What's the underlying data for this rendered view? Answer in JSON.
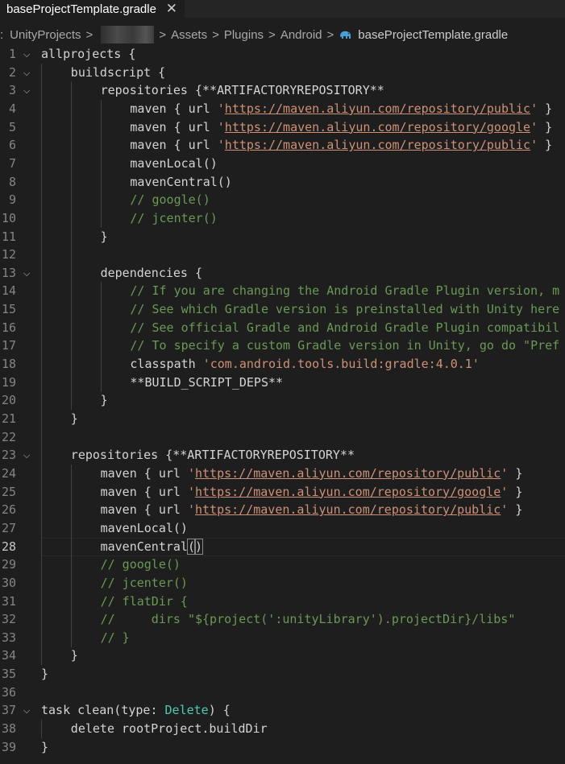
{
  "tab": {
    "title": "baseProjectTemplate.gradle",
    "close_glyph": "✕"
  },
  "breadcrumb": {
    "lead": ":",
    "items": [
      "UnityProjects",
      "Assets",
      "Plugins",
      "Android"
    ],
    "file": "baseProjectTemplate.gradle",
    "separator": ">"
  },
  "editor": {
    "active_line": 28,
    "lines": [
      {
        "n": "1",
        "fold": true,
        "indent": 0,
        "tokens": [
          {
            "t": "allprojects {",
            "c": "kw"
          }
        ]
      },
      {
        "n": "2",
        "fold": true,
        "indent": 1,
        "tokens": [
          {
            "t": "buildscript {",
            "c": "kw"
          }
        ]
      },
      {
        "n": "3",
        "fold": true,
        "indent": 2,
        "tokens": [
          {
            "t": "repositories {**ARTIFACTORYREPOSITORY**",
            "c": "kw"
          }
        ]
      },
      {
        "n": "4",
        "fold": false,
        "indent": 3,
        "tokens": [
          {
            "t": "maven { url ",
            "c": "kw"
          },
          {
            "t": "'",
            "c": "str"
          },
          {
            "t": "https://maven.aliyun.com/repository/public",
            "c": "url"
          },
          {
            "t": "'",
            "c": "str"
          },
          {
            "t": " }",
            "c": "kw"
          }
        ]
      },
      {
        "n": "5",
        "fold": false,
        "indent": 3,
        "tokens": [
          {
            "t": "maven { url ",
            "c": "kw"
          },
          {
            "t": "'",
            "c": "str"
          },
          {
            "t": "https://maven.aliyun.com/repository/google",
            "c": "url"
          },
          {
            "t": "'",
            "c": "str"
          },
          {
            "t": " }",
            "c": "kw"
          }
        ]
      },
      {
        "n": "6",
        "fold": false,
        "indent": 3,
        "tokens": [
          {
            "t": "maven { url ",
            "c": "kw"
          },
          {
            "t": "'",
            "c": "str"
          },
          {
            "t": "https://maven.aliyun.com/repository/public",
            "c": "url"
          },
          {
            "t": "'",
            "c": "str"
          },
          {
            "t": " }",
            "c": "kw"
          }
        ]
      },
      {
        "n": "7",
        "fold": false,
        "indent": 3,
        "tokens": [
          {
            "t": "mavenLocal()",
            "c": "kw"
          }
        ]
      },
      {
        "n": "8",
        "fold": false,
        "indent": 3,
        "tokens": [
          {
            "t": "mavenCentral()",
            "c": "kw"
          }
        ]
      },
      {
        "n": "9",
        "fold": false,
        "indent": 3,
        "tokens": [
          {
            "t": "// google()",
            "c": "cmt"
          }
        ]
      },
      {
        "n": "10",
        "fold": false,
        "indent": 3,
        "tokens": [
          {
            "t": "// jcenter()",
            "c": "cmt"
          }
        ]
      },
      {
        "n": "11",
        "fold": false,
        "indent": 2,
        "tokens": [
          {
            "t": "}",
            "c": "kw"
          }
        ]
      },
      {
        "n": "12",
        "fold": false,
        "indent": 2,
        "tokens": []
      },
      {
        "n": "13",
        "fold": true,
        "indent": 2,
        "tokens": [
          {
            "t": "dependencies {",
            "c": "kw"
          }
        ]
      },
      {
        "n": "14",
        "fold": false,
        "indent": 3,
        "tokens": [
          {
            "t": "// If you are changing the Android Gradle Plugin version, m",
            "c": "cmt"
          }
        ]
      },
      {
        "n": "15",
        "fold": false,
        "indent": 3,
        "tokens": [
          {
            "t": "// See which Gradle version is preinstalled with Unity here",
            "c": "cmt"
          }
        ]
      },
      {
        "n": "16",
        "fold": false,
        "indent": 3,
        "tokens": [
          {
            "t": "// See official Gradle and Android Gradle Plugin compatibil",
            "c": "cmt"
          }
        ]
      },
      {
        "n": "17",
        "fold": false,
        "indent": 3,
        "tokens": [
          {
            "t": "// To specify a custom Gradle version in Unity, go do \"Pref",
            "c": "cmt"
          }
        ]
      },
      {
        "n": "18",
        "fold": false,
        "indent": 3,
        "tokens": [
          {
            "t": "classpath ",
            "c": "kw"
          },
          {
            "t": "'com.android.tools.build:gradle:4.0.1'",
            "c": "str"
          }
        ]
      },
      {
        "n": "19",
        "fold": false,
        "indent": 3,
        "tokens": [
          {
            "t": "**BUILD_SCRIPT_DEPS**",
            "c": "kw"
          }
        ]
      },
      {
        "n": "20",
        "fold": false,
        "indent": 2,
        "tokens": [
          {
            "t": "}",
            "c": "kw"
          }
        ]
      },
      {
        "n": "21",
        "fold": false,
        "indent": 1,
        "tokens": [
          {
            "t": "}",
            "c": "kw"
          }
        ]
      },
      {
        "n": "22",
        "fold": false,
        "indent": 1,
        "tokens": []
      },
      {
        "n": "23",
        "fold": true,
        "indent": 1,
        "tokens": [
          {
            "t": "repositories {**ARTIFACTORYREPOSITORY**",
            "c": "kw"
          }
        ]
      },
      {
        "n": "24",
        "fold": false,
        "indent": 2,
        "tokens": [
          {
            "t": "maven { url ",
            "c": "kw"
          },
          {
            "t": "'",
            "c": "str"
          },
          {
            "t": "https://maven.aliyun.com/repository/public",
            "c": "url"
          },
          {
            "t": "'",
            "c": "str"
          },
          {
            "t": " }",
            "c": "kw"
          }
        ]
      },
      {
        "n": "25",
        "fold": false,
        "indent": 2,
        "tokens": [
          {
            "t": "maven { url ",
            "c": "kw"
          },
          {
            "t": "'",
            "c": "str"
          },
          {
            "t": "https://maven.aliyun.com/repository/google",
            "c": "url"
          },
          {
            "t": "'",
            "c": "str"
          },
          {
            "t": " }",
            "c": "kw"
          }
        ]
      },
      {
        "n": "26",
        "fold": false,
        "indent": 2,
        "tokens": [
          {
            "t": "maven { url ",
            "c": "kw"
          },
          {
            "t": "'",
            "c": "str"
          },
          {
            "t": "https://maven.aliyun.com/repository/public",
            "c": "url"
          },
          {
            "t": "'",
            "c": "str"
          },
          {
            "t": " }",
            "c": "kw"
          }
        ]
      },
      {
        "n": "27",
        "fold": false,
        "indent": 2,
        "tokens": [
          {
            "t": "mavenLocal()",
            "c": "kw"
          }
        ]
      },
      {
        "n": "28",
        "fold": false,
        "indent": 2,
        "tokens": [
          {
            "t": "mavenCentral",
            "c": "kw"
          },
          {
            "t": "(",
            "c": "br"
          },
          {
            "t": ")",
            "c": "br"
          }
        ]
      },
      {
        "n": "29",
        "fold": false,
        "indent": 2,
        "tokens": [
          {
            "t": "// google()",
            "c": "cmt"
          }
        ]
      },
      {
        "n": "30",
        "fold": false,
        "indent": 2,
        "tokens": [
          {
            "t": "// jcenter()",
            "c": "cmt"
          }
        ]
      },
      {
        "n": "31",
        "fold": false,
        "indent": 2,
        "tokens": [
          {
            "t": "// flatDir {",
            "c": "cmt"
          }
        ]
      },
      {
        "n": "32",
        "fold": false,
        "indent": 2,
        "tokens": [
          {
            "t": "//     dirs \"${project(':unityLibrary').projectDir}/libs\"",
            "c": "cmt"
          }
        ]
      },
      {
        "n": "33",
        "fold": false,
        "indent": 2,
        "tokens": [
          {
            "t": "// }",
            "c": "cmt"
          }
        ]
      },
      {
        "n": "34",
        "fold": false,
        "indent": 1,
        "tokens": [
          {
            "t": "}",
            "c": "kw"
          }
        ]
      },
      {
        "n": "35",
        "fold": false,
        "indent": 0,
        "tokens": [
          {
            "t": "}",
            "c": "kw"
          }
        ]
      },
      {
        "n": "36",
        "fold": false,
        "indent": 0,
        "tokens": []
      },
      {
        "n": "37",
        "fold": true,
        "indent": 0,
        "tokens": [
          {
            "t": "task clean(type: ",
            "c": "kw"
          },
          {
            "t": "Delete",
            "c": "type"
          },
          {
            "t": ") {",
            "c": "kw"
          }
        ]
      },
      {
        "n": "38",
        "fold": false,
        "indent": 1,
        "tokens": [
          {
            "t": "delete rootProject.buildDir",
            "c": "kw"
          }
        ]
      },
      {
        "n": "39",
        "fold": false,
        "indent": 0,
        "tokens": [
          {
            "t": "}",
            "c": "kw"
          }
        ]
      }
    ]
  },
  "colors": {
    "background": "#1e1e1e",
    "string": "#ce9178",
    "comment": "#6a9955",
    "type": "#4ec9b0",
    "line_number": "#858585"
  }
}
